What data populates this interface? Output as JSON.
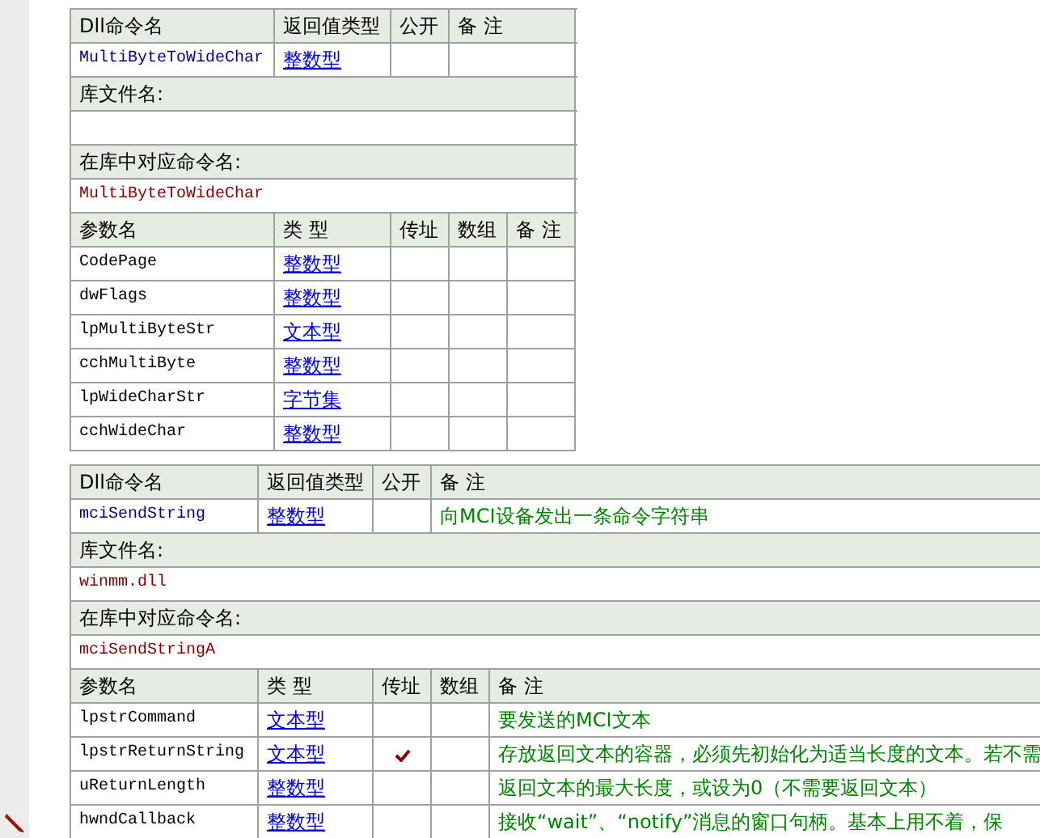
{
  "dll_commands": [
    {
      "header": {
        "name": "Dll命令名",
        "return_type": "返回值类型",
        "public": "公开",
        "note": "备 注"
      },
      "command": {
        "name": "MultiByteToWideChar",
        "return_type": "整数型",
        "public": false
      },
      "library_label": "库文件名:",
      "alias_label": "在库中对应命令名:",
      "alias": "MultiByteToWideChar",
      "param_header": {
        "name": "参数名",
        "type": "类 型",
        "by_ref": "传址",
        "array": "数组",
        "note": "备 注"
      },
      "params": [
        {
          "name": "CodePage",
          "type": "整数型",
          "by_ref": false,
          "array": false
        },
        {
          "name": "dwFlags",
          "type": "整数型",
          "by_ref": false,
          "array": false
        },
        {
          "name": "lpMultiByteStr",
          "type": "文本型",
          "by_ref": false,
          "array": false
        },
        {
          "name": "cchMultiByte",
          "type": "整数型",
          "by_ref": false,
          "array": false
        },
        {
          "name": "lpWideCharStr",
          "type": "字节集",
          "by_ref": false,
          "array": false
        },
        {
          "name": "cchWideChar",
          "type": "整数型",
          "by_ref": false,
          "array": false
        }
      ]
    },
    {
      "header": {
        "name": "Dll命令名",
        "return_type": "返回值类型",
        "public": "公开",
        "note": "备 注"
      },
      "command": {
        "name": "mciSendString",
        "return_type": "整数型",
        "public": false,
        "note": "向MCI设备发出一条命令字符串"
      },
      "library_label": "库文件名:",
      "library": "winmm.dll",
      "alias_label": "在库中对应命令名:",
      "alias": "mciSendStringA",
      "param_header": {
        "name": "参数名",
        "type": "类 型",
        "by_ref": "传址",
        "array": "数组",
        "note": "备 注"
      },
      "params": [
        {
          "name": "lpstrCommand",
          "type": "文本型",
          "by_ref": false,
          "array": false,
          "note": "要发送的MCI文本"
        },
        {
          "name": "lpstrReturnString",
          "type": "文本型",
          "by_ref": true,
          "array": false,
          "note": "存放返回文本的容器，必须先初始化为适当长度的文本。若不需"
        },
        {
          "name": "uReturnLength",
          "type": "整数型",
          "by_ref": false,
          "array": false,
          "note": "返回文本的最大长度，或设为0（不需要返回文本）"
        },
        {
          "name": "hwndCallback",
          "type": "整数型",
          "by_ref": false,
          "array": false,
          "note": "接收“wait”、“notify”消息的窗口句柄。基本上用不着，保"
        }
      ]
    }
  ]
}
